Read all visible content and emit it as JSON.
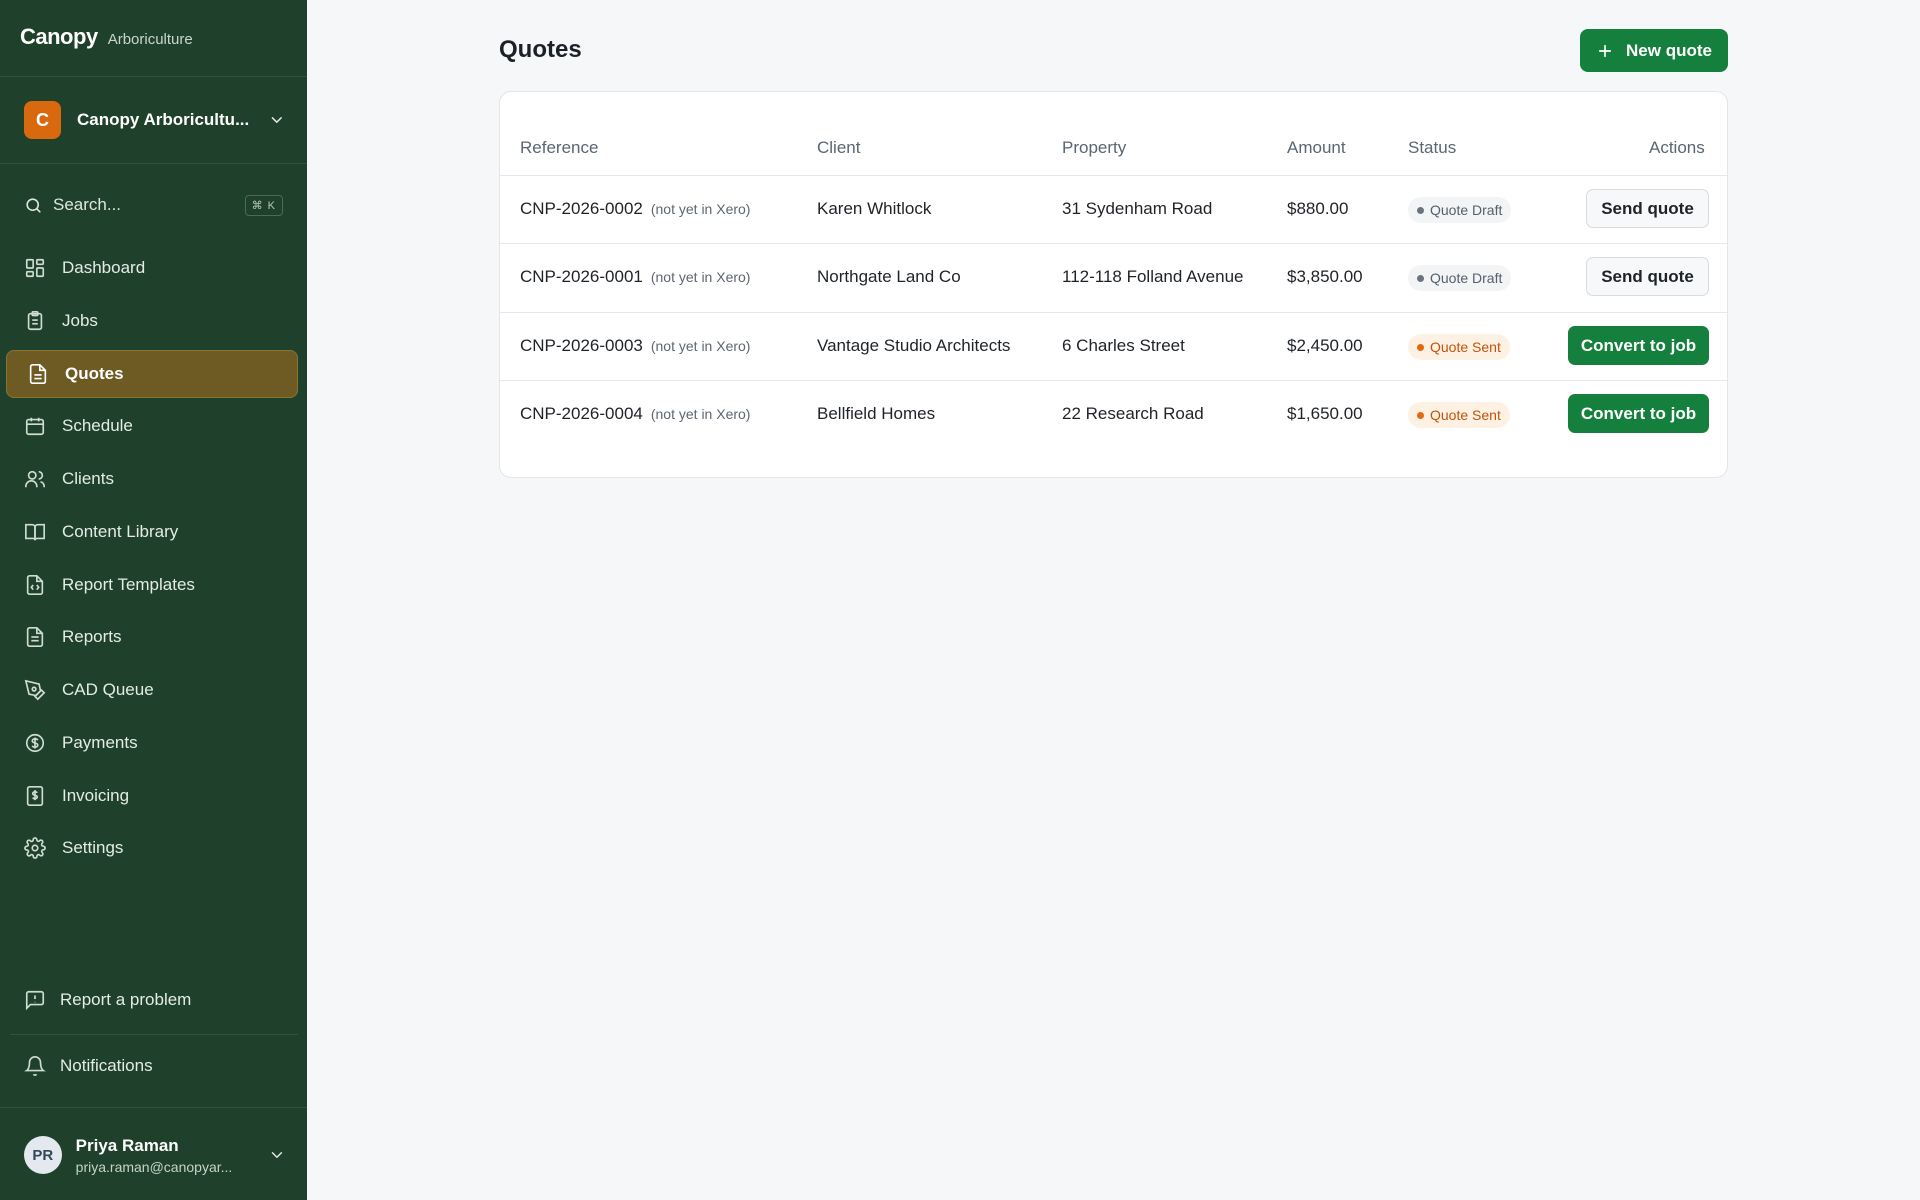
{
  "sidebar": {
    "brand": {
      "name": "Canopy",
      "subtitle": "Arboriculture"
    },
    "org": {
      "initial": "C",
      "name": "Canopy Arboricultu..."
    },
    "search": {
      "placeholder": "Search...",
      "shortcut": "⌘ K"
    },
    "nav": [
      {
        "label": "Dashboard",
        "icon": "dashboard-icon",
        "active": false
      },
      {
        "label": "Jobs",
        "icon": "clipboard-icon",
        "active": false
      },
      {
        "label": "Quotes",
        "icon": "document-icon",
        "active": true
      },
      {
        "label": "Schedule",
        "icon": "calendar-icon",
        "active": false
      },
      {
        "label": "Clients",
        "icon": "users-icon",
        "active": false
      },
      {
        "label": "Content Library",
        "icon": "book-icon",
        "active": false
      },
      {
        "label": "Report Templates",
        "icon": "file-code-icon",
        "active": false
      },
      {
        "label": "Reports",
        "icon": "file-text-icon",
        "active": false
      },
      {
        "label": "CAD Queue",
        "icon": "pen-tool-icon",
        "active": false
      },
      {
        "label": "Payments",
        "icon": "dollar-circle-icon",
        "active": false
      },
      {
        "label": "Invoicing",
        "icon": "invoice-icon",
        "active": false
      },
      {
        "label": "Settings",
        "icon": "gear-icon",
        "active": false
      }
    ],
    "report_problem": "Report a problem",
    "notifications": "Notifications",
    "user": {
      "initials": "PR",
      "name": "Priya Raman",
      "email": "priya.raman@canopyar..."
    }
  },
  "main": {
    "title": "Quotes",
    "new_button": "New quote",
    "table": {
      "headers": [
        "Reference",
        "Client",
        "Property",
        "Amount",
        "Status",
        "Actions"
      ],
      "rows": [
        {
          "reference": "CNP-2026-0002",
          "note": "(not yet in Xero)",
          "client": "Karen Whitlock",
          "property": "31 Sydenham Road",
          "amount": "$880.00",
          "status": "Quote Draft",
          "action": "Send quote"
        },
        {
          "reference": "CNP-2026-0001",
          "note": "(not yet in Xero)",
          "client": "Northgate Land Co",
          "property": "112-118 Folland Avenue",
          "amount": "$3,850.00",
          "status": "Quote Draft",
          "action": "Send quote"
        },
        {
          "reference": "CNP-2026-0003",
          "note": "(not yet in Xero)",
          "client": "Vantage Studio Architects",
          "property": "6 Charles Street",
          "amount": "$2,450.00",
          "status": "Quote Sent",
          "action": "Convert to job"
        },
        {
          "reference": "CNP-2026-0004",
          "note": "(not yet in Xero)",
          "client": "Bellfield Homes",
          "property": "22 Research Road",
          "amount": "$1,650.00",
          "status": "Quote Sent",
          "action": "Convert to job"
        }
      ]
    }
  },
  "colors": {
    "sidebar_bg": "#1f402a",
    "active_nav": "#6e5a23",
    "primary": "#15803d",
    "org_badge": "#d9690f",
    "sent_badge": "#c2540a"
  }
}
